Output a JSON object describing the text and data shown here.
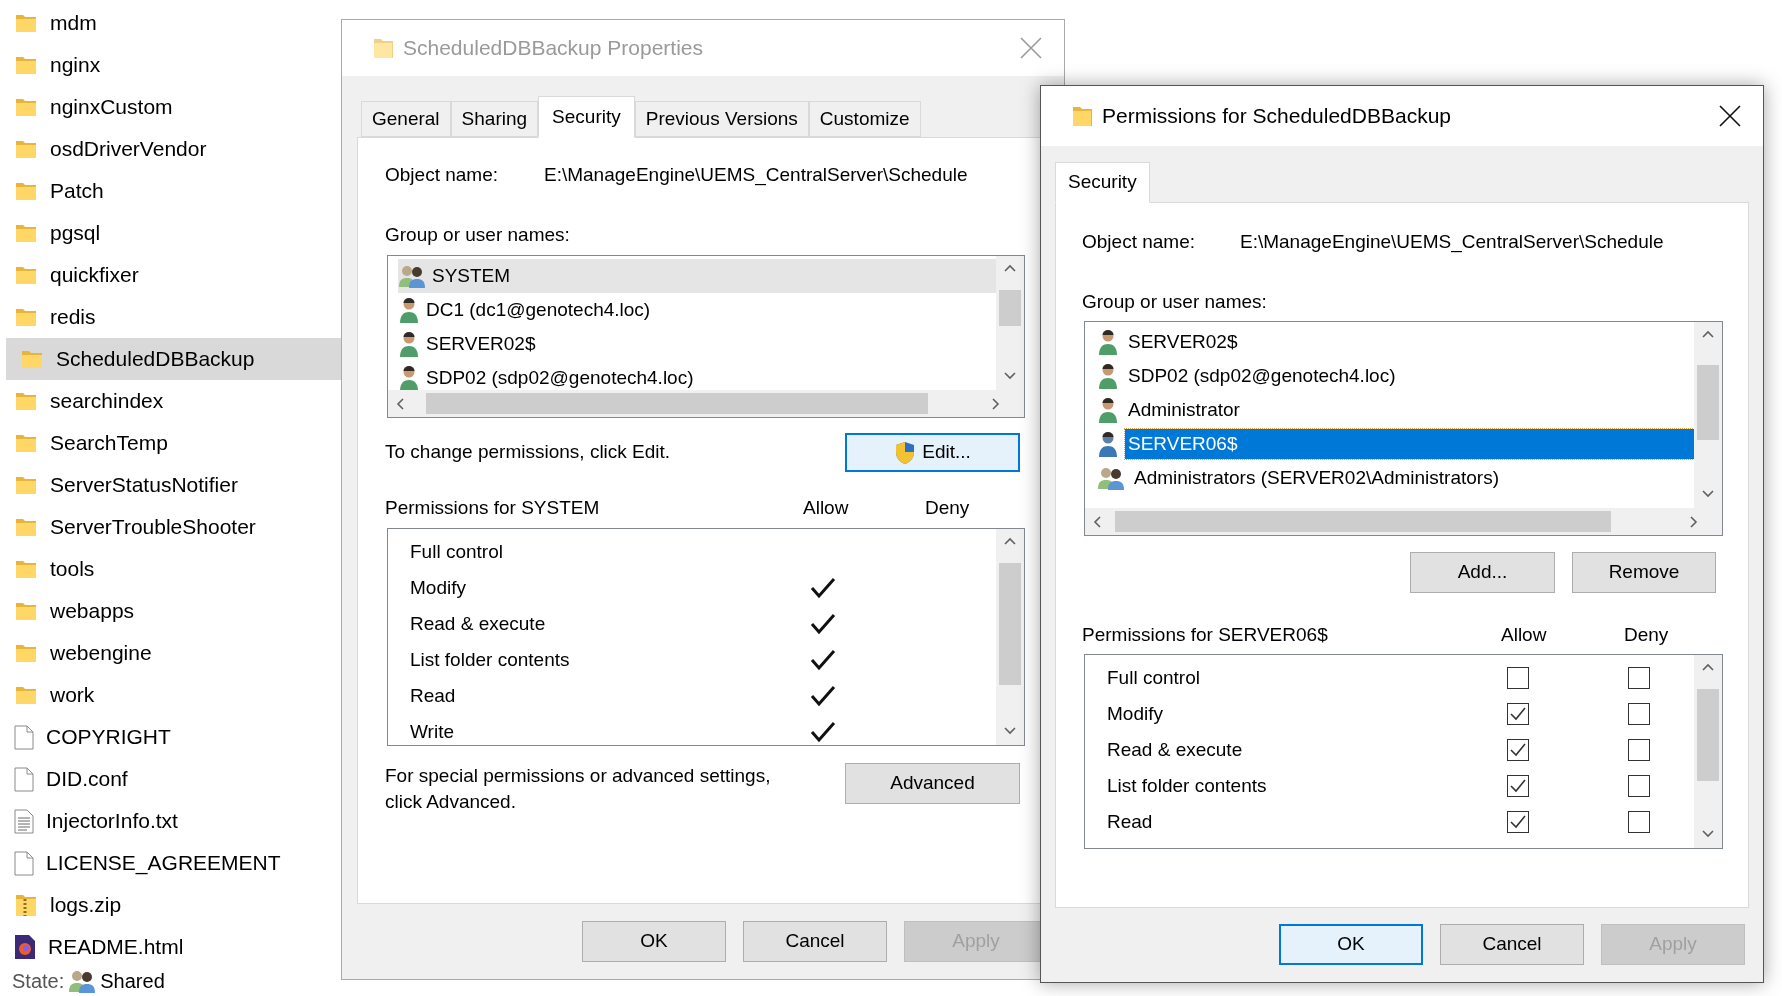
{
  "explorer": {
    "items": [
      {
        "name": "mdm",
        "kind": "folder",
        "selected": false
      },
      {
        "name": "nginx",
        "kind": "folder",
        "selected": false
      },
      {
        "name": "nginxCustom",
        "kind": "folder",
        "selected": false
      },
      {
        "name": "osdDriverVendor",
        "kind": "folder",
        "selected": false
      },
      {
        "name": "Patch",
        "kind": "folder",
        "selected": false
      },
      {
        "name": "pgsql",
        "kind": "folder",
        "selected": false
      },
      {
        "name": "quickfixer",
        "kind": "folder",
        "selected": false
      },
      {
        "name": "redis",
        "kind": "folder",
        "selected": false
      },
      {
        "name": "ScheduledDBBackup",
        "kind": "folder",
        "selected": true
      },
      {
        "name": "searchindex",
        "kind": "folder",
        "selected": false
      },
      {
        "name": "SearchTemp",
        "kind": "folder",
        "selected": false
      },
      {
        "name": "ServerStatusNotifier",
        "kind": "folder",
        "selected": false
      },
      {
        "name": "ServerTroubleShooter",
        "kind": "folder",
        "selected": false
      },
      {
        "name": "tools",
        "kind": "folder",
        "selected": false
      },
      {
        "name": "webapps",
        "kind": "folder",
        "selected": false
      },
      {
        "name": "webengine",
        "kind": "folder",
        "selected": false
      },
      {
        "name": "work",
        "kind": "folder",
        "selected": false
      },
      {
        "name": "COPYRIGHT",
        "kind": "file",
        "selected": false
      },
      {
        "name": "DID.conf",
        "kind": "file",
        "selected": false
      },
      {
        "name": "InjectorInfo.txt",
        "kind": "text",
        "selected": false
      },
      {
        "name": "LICENSE_AGREEMENT",
        "kind": "file",
        "selected": false
      },
      {
        "name": "logs.zip",
        "kind": "zip",
        "selected": false
      },
      {
        "name": "README.html",
        "kind": "html",
        "selected": false
      }
    ],
    "status": {
      "label": "State:",
      "value": "Shared"
    }
  },
  "properties_dialog": {
    "title": "ScheduledDBBackup Properties",
    "active": false,
    "tabs": [
      {
        "label": "General",
        "selected": false
      },
      {
        "label": "Sharing",
        "selected": false
      },
      {
        "label": "Security",
        "selected": true
      },
      {
        "label": "Previous Versions",
        "selected": false
      },
      {
        "label": "Customize",
        "selected": false
      }
    ],
    "object_name_label": "Object name:",
    "object_name": "E:\\ManageEngine\\UEMS_CentralServer\\Schedule",
    "group_label": "Group or user names:",
    "principals": [
      {
        "name": "SYSTEM",
        "kind": "group",
        "selected": true
      },
      {
        "name": "DC1 (dc1@genotech4.loc)",
        "kind": "user",
        "selected": false
      },
      {
        "name": "SERVER02$",
        "kind": "user",
        "selected": false
      },
      {
        "name": "SDP02 (sdp02@genotech4.loc)",
        "kind": "user",
        "selected": false
      }
    ],
    "change_hint": "To change permissions, click Edit.",
    "edit_button": {
      "label": "Edit...",
      "default": true
    },
    "permissions_label": "Permissions for SYSTEM",
    "allow_label": "Allow",
    "deny_label": "Deny",
    "permissions": [
      {
        "name": "Full control",
        "allow": false,
        "deny": false
      },
      {
        "name": "Modify",
        "allow": true,
        "deny": false
      },
      {
        "name": "Read & execute",
        "allow": true,
        "deny": false
      },
      {
        "name": "List folder contents",
        "allow": true,
        "deny": false
      },
      {
        "name": "Read",
        "allow": true,
        "deny": false
      },
      {
        "name": "Write",
        "allow": true,
        "deny": false
      }
    ],
    "advanced_hint": [
      "For special permissions or advanced settings,",
      "click Advanced."
    ],
    "advanced_button": {
      "label": "Advanced",
      "default": false
    },
    "buttons": [
      {
        "label": "OK",
        "default": false,
        "disabled": false
      },
      {
        "label": "Cancel",
        "default": false,
        "disabled": false
      },
      {
        "label": "Apply",
        "default": false,
        "disabled": true
      }
    ]
  },
  "permissions_dialog": {
    "title": "Permissions for ScheduledDBBackup",
    "active": true,
    "tabs": [
      {
        "label": "Security",
        "selected": true
      }
    ],
    "object_name_label": "Object name:",
    "object_name": "E:\\ManageEngine\\UEMS_CentralServer\\Schedule",
    "group_label": "Group or user names:",
    "principals": [
      {
        "name": "SERVER02$",
        "kind": "user",
        "selected": false
      },
      {
        "name": "SDP02 (sdp02@genotech4.loc)",
        "kind": "user",
        "selected": false
      },
      {
        "name": "Administrator",
        "kind": "user",
        "selected": false
      },
      {
        "name": "SERVER06$",
        "kind": "user",
        "selected": true
      },
      {
        "name": "Administrators (SERVER02\\Administrators)",
        "kind": "group",
        "selected": false
      }
    ],
    "add_button": {
      "label": "Add...",
      "default": false
    },
    "remove_button": {
      "label": "Remove",
      "default": false
    },
    "permissions_label": "Permissions for SERVER06$",
    "allow_label": "Allow",
    "deny_label": "Deny",
    "permissions": [
      {
        "name": "Full control",
        "allow": false,
        "deny": false
      },
      {
        "name": "Modify",
        "allow": true,
        "deny": false
      },
      {
        "name": "Read & execute",
        "allow": true,
        "deny": false
      },
      {
        "name": "List folder contents",
        "allow": true,
        "deny": false
      },
      {
        "name": "Read",
        "allow": true,
        "deny": false
      }
    ],
    "buttons": [
      {
        "label": "OK",
        "default": true,
        "disabled": false
      },
      {
        "label": "Cancel",
        "default": false,
        "disabled": false
      },
      {
        "label": "Apply",
        "default": false,
        "disabled": true
      }
    ]
  }
}
